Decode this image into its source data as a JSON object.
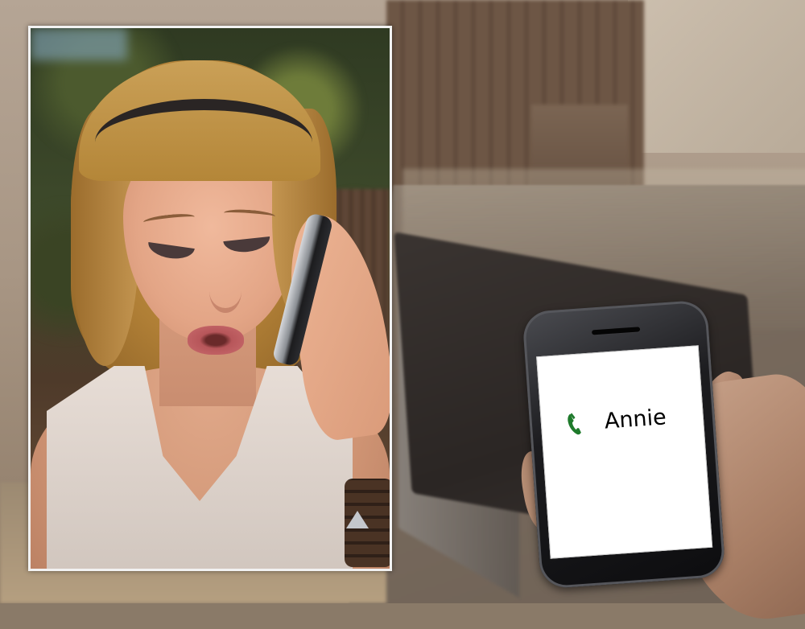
{
  "phone": {
    "caller_name": "Annie",
    "call_icon": "phone-handset-icon",
    "call_icon_color": "#1e7a2b"
  },
  "colors": {
    "frame_border": "#f2f2f2",
    "screen_bg": "#ffffff"
  }
}
